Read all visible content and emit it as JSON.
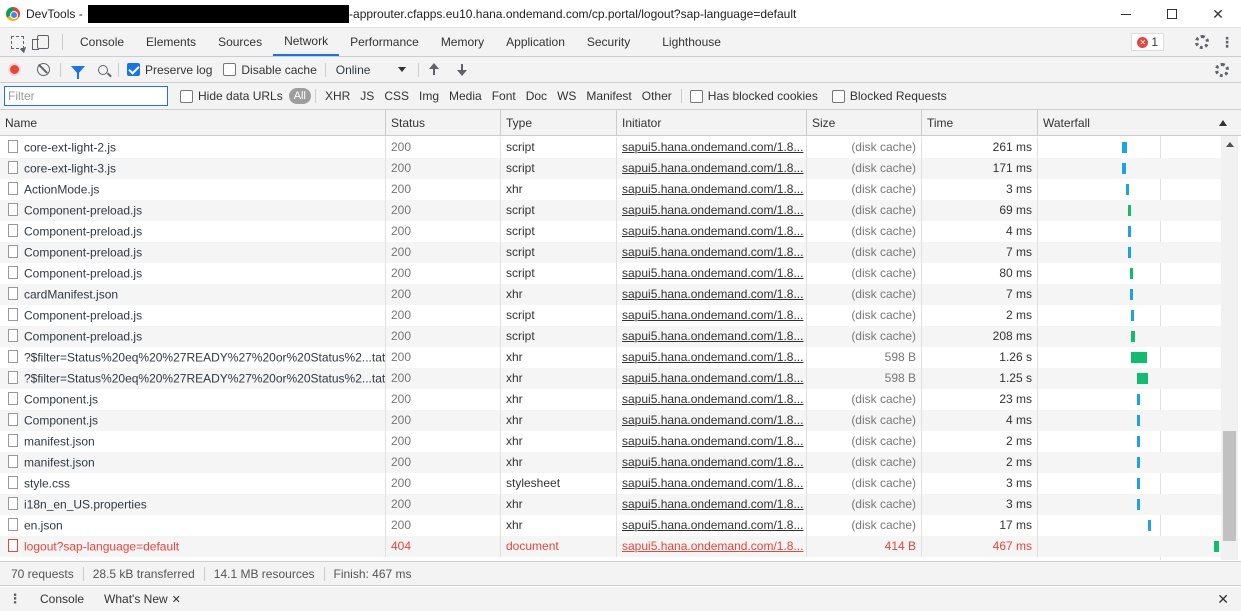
{
  "window": {
    "app": "DevTools",
    "title_sep": " - ",
    "url_suffix": "-approuter.cfapps.eu10.hana.ondemand.com/cp.portal/logout?sap-language=default",
    "min_icon": "minimize-icon",
    "max_icon": "maximize-icon",
    "close_label": "✕"
  },
  "tabs": [
    "Console",
    "Elements",
    "Sources",
    "Network",
    "Performance",
    "Memory",
    "Application",
    "Security",
    "Lighthouse"
  ],
  "active_tab": "Network",
  "errors": {
    "count": "1"
  },
  "toolbar": {
    "preserve_log": "Preserve log",
    "disable_cache": "Disable cache",
    "throttling": "Online"
  },
  "filter": {
    "placeholder": "Filter",
    "hide_data_urls": "Hide data URLs",
    "all": "All",
    "types": [
      "XHR",
      "JS",
      "CSS",
      "Img",
      "Media",
      "Font",
      "Doc",
      "WS",
      "Manifest",
      "Other"
    ],
    "has_blocked_cookies": "Has blocked cookies",
    "blocked_requests": "Blocked Requests"
  },
  "columns": {
    "name": "Name",
    "status": "Status",
    "type": "Type",
    "initiator": "Initiator",
    "size": "Size",
    "time": "Time",
    "waterfall": "Waterfall"
  },
  "rows": [
    {
      "name": "core-ext-light-2.js",
      "status": "200",
      "type": "script",
      "initiator": "sapui5.hana.ondemand.com/1.8...",
      "size": "(disk cache)",
      "time": "261 ms",
      "wf_start": 0.46,
      "wf_width": 0.03,
      "wf_color": "#1aa3e8"
    },
    {
      "name": "core-ext-light-3.js",
      "status": "200",
      "type": "script",
      "initiator": "sapui5.hana.ondemand.com/1.8...",
      "size": "(disk cache)",
      "time": "171 ms",
      "wf_start": 0.46,
      "wf_width": 0.02,
      "wf_color": "#1aa3e8"
    },
    {
      "name": "ActionMode.js",
      "status": "200",
      "type": "xhr",
      "initiator": "sapui5.hana.ondemand.com/1.8...",
      "size": "(disk cache)",
      "time": "3 ms",
      "wf_start": 0.48,
      "wf_width": 0.01,
      "wf_color": "#1aa3e8"
    },
    {
      "name": "Component-preload.js",
      "status": "200",
      "type": "script",
      "initiator": "sapui5.hana.ondemand.com/1.8...",
      "size": "(disk cache)",
      "time": "69 ms",
      "wf_start": 0.49,
      "wf_width": 0.01,
      "wf_color": "#0fbd6f"
    },
    {
      "name": "Component-preload.js",
      "status": "200",
      "type": "script",
      "initiator": "sapui5.hana.ondemand.com/1.8...",
      "size": "(disk cache)",
      "time": "4 ms",
      "wf_start": 0.49,
      "wf_width": 0.01,
      "wf_color": "#1aa3e8"
    },
    {
      "name": "Component-preload.js",
      "status": "200",
      "type": "script",
      "initiator": "sapui5.hana.ondemand.com/1.8...",
      "size": "(disk cache)",
      "time": "7 ms",
      "wf_start": 0.49,
      "wf_width": 0.01,
      "wf_color": "#1aa3e8"
    },
    {
      "name": "Component-preload.js",
      "status": "200",
      "type": "script",
      "initiator": "sapui5.hana.ondemand.com/1.8...",
      "size": "(disk cache)",
      "time": "80 ms",
      "wf_start": 0.5,
      "wf_width": 0.01,
      "wf_color": "#0fbd6f"
    },
    {
      "name": "cardManifest.json",
      "status": "200",
      "type": "xhr",
      "initiator": "sapui5.hana.ondemand.com/1.8...",
      "size": "(disk cache)",
      "time": "7 ms",
      "wf_start": 0.5,
      "wf_width": 0.01,
      "wf_color": "#1aa3e8"
    },
    {
      "name": "Component-preload.js",
      "status": "200",
      "type": "script",
      "initiator": "sapui5.hana.ondemand.com/1.8...",
      "size": "(disk cache)",
      "time": "2 ms",
      "wf_start": 0.51,
      "wf_width": 0.01,
      "wf_color": "#1aa3e8"
    },
    {
      "name": "Component-preload.js",
      "status": "200",
      "type": "script",
      "initiator": "sapui5.hana.ondemand.com/1.8...",
      "size": "(disk cache)",
      "time": "208 ms",
      "wf_start": 0.51,
      "wf_width": 0.02,
      "wf_color": "#0fbd6f"
    },
    {
      "name": "?$filter=Status%20eq%20%27READY%27%20or%20Status%2...tat...",
      "status": "200",
      "type": "xhr",
      "initiator": "sapui5.hana.ondemand.com/1.8...",
      "size": "598 B",
      "time": "1.26 s",
      "wf_start": 0.51,
      "wf_width": 0.09,
      "wf_color": "#0fbd6f"
    },
    {
      "name": "?$filter=Status%20eq%20%27READY%27%20or%20Status%2...tat...",
      "status": "200",
      "type": "xhr",
      "initiator": "sapui5.hana.ondemand.com/1.8...",
      "size": "598 B",
      "time": "1.25 s",
      "wf_start": 0.54,
      "wf_width": 0.06,
      "wf_color": "#0fbd6f"
    },
    {
      "name": "Component.js",
      "status": "200",
      "type": "xhr",
      "initiator": "sapui5.hana.ondemand.com/1.8...",
      "size": "(disk cache)",
      "time": "23 ms",
      "wf_start": 0.54,
      "wf_width": 0.01,
      "wf_color": "#1aa3e8"
    },
    {
      "name": "Component.js",
      "status": "200",
      "type": "xhr",
      "initiator": "sapui5.hana.ondemand.com/1.8...",
      "size": "(disk cache)",
      "time": "4 ms",
      "wf_start": 0.54,
      "wf_width": 0.01,
      "wf_color": "#1aa3e8"
    },
    {
      "name": "manifest.json",
      "status": "200",
      "type": "xhr",
      "initiator": "sapui5.hana.ondemand.com/1.8...",
      "size": "(disk cache)",
      "time": "2 ms",
      "wf_start": 0.54,
      "wf_width": 0.01,
      "wf_color": "#1aa3e8"
    },
    {
      "name": "manifest.json",
      "status": "200",
      "type": "xhr",
      "initiator": "sapui5.hana.ondemand.com/1.8...",
      "size": "(disk cache)",
      "time": "2 ms",
      "wf_start": 0.54,
      "wf_width": 0.01,
      "wf_color": "#1aa3e8"
    },
    {
      "name": "style.css",
      "status": "200",
      "type": "stylesheet",
      "initiator": "sapui5.hana.ondemand.com/1.8...",
      "size": "(disk cache)",
      "time": "3 ms",
      "wf_start": 0.54,
      "wf_width": 0.01,
      "wf_color": "#1aa3e8"
    },
    {
      "name": "i18n_en_US.properties",
      "status": "200",
      "type": "xhr",
      "initiator": "sapui5.hana.ondemand.com/1.8...",
      "size": "(disk cache)",
      "time": "3 ms",
      "wf_start": 0.54,
      "wf_width": 0.01,
      "wf_color": "#1aa3e8"
    },
    {
      "name": "en.json",
      "status": "200",
      "type": "xhr",
      "initiator": "sapui5.hana.ondemand.com/1.8...",
      "size": "(disk cache)",
      "time": "17 ms",
      "wf_start": 0.6,
      "wf_width": 0.01,
      "wf_color": "#1aa3e8"
    },
    {
      "name": "logout?sap-language=default",
      "status": "404",
      "type": "document",
      "initiator": "sapui5.hana.ondemand.com/1.8...",
      "size": "414 B",
      "time": "467 ms",
      "wf_start": 0.96,
      "wf_width": 0.03,
      "wf_color": "#0fbd6f",
      "error": true
    }
  ],
  "status": {
    "requests": "70 requests",
    "transferred": "28.5 kB transferred",
    "resources": "14.1 MB resources",
    "finish": "Finish: 467 ms"
  },
  "drawer": {
    "console": "Console",
    "whats_new": "What's New",
    "close": "✕"
  }
}
